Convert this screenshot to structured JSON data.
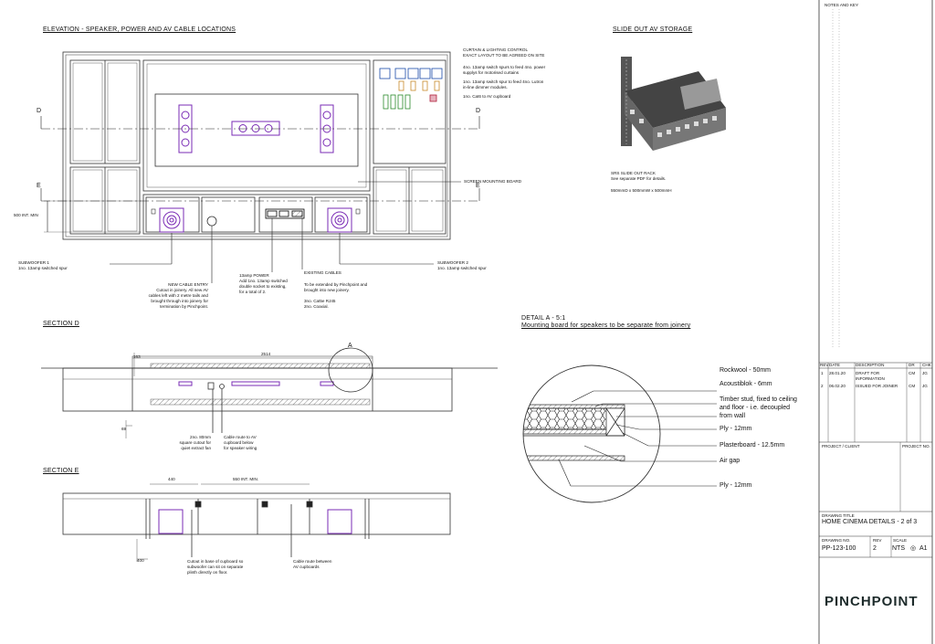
{
  "headings": {
    "elevation": "ELEVATION - SPEAKER, POWER AND AV CABLE  LOCATIONS",
    "slide_out": "SLIDE OUT AV STORAGE",
    "section_d": "SECTION D",
    "section_e": "SECTION E",
    "detail_a": "DETAIL A - 5:1",
    "detail_a_sub": "Mounting board for speakers to be separate from joinery"
  },
  "elevation_notes": {
    "curtain_title": "CURTAIN & LIGHTING CONTROL",
    "curtain_sub": "EXACT LAYOUT TO BE AGREED ON SITE",
    "curtain_1": "4no. 13amp switch spurs to feed 4no. power\nsupplys for motorised curtains",
    "curtain_2": "1no. 13amp switch spur to feed 4no. Lutron\nin-line dimmer modules.",
    "curtain_3": "1no. Cat6 to AV cupboard",
    "screen_board": "SCREEN MOUNTING BOARD",
    "sub1": "SUBWOOFER 1\n1no. 13amp switched spur",
    "sub2": "SUBWOOFER 2\n1no. 13amp switched spur",
    "cable_entry": "NEW CABLE ENTRY\nCutout in joinery. All new AV\ncables left with 2 metre tails and\nbrought through into joinery for\ntermination by Pinchpoint.",
    "power": "13amp POWER\nAdd 1no. 13amp switched\ndouble socket to existing,\nfor a total of 2.",
    "existing": "EXISTING CABLES",
    "existing_body": "To be extended by Pinchpoint and\nbrought into new joinery.\n\n3no. Cat5e RJ45\n2no. Coaxial.",
    "min_500": "500 INT. MIN",
    "marker_d": "D",
    "marker_e": "E"
  },
  "rack": {
    "title": "SRS SLIDE OUT RACK",
    "note": "See separate PDF for details.",
    "dims": "550mmD x 500mmW x 500mmH"
  },
  "section_d": {
    "dim_163": "163",
    "dim_2514": "2514",
    "dim_69": "69",
    "detail_marker": "A",
    "fan_note": "2no. 80mm\nsquare cutout for\nquiet extract fan",
    "route_note": "Cable route to AV\ncupboard below\nfor speaker wiring"
  },
  "section_e": {
    "dim_440": "440",
    "dim_550": "550 INT. MIN.",
    "dim_400": "400",
    "cutout_note": "Cutout in base of cupboard so\nsubwoofer can sit on separate\nplinth directly on floor.",
    "route_note": "Cable route between\nAV cupboards"
  },
  "detail_labels": {
    "rockwool": "Rockwool - 50mm",
    "acoustiblok": "Acoustiblok - 6mm",
    "timber": "Timber stud, fixed to ceiling\nand floor - i.e. decoupled\nfrom wall",
    "ply1": "Ply - 12mm",
    "plasterboard": "Plasterboard - 12.5mm",
    "air_gap": "Air gap",
    "ply2": "Ply - 12mm"
  },
  "title_block": {
    "notes_key": "NOTES AND KEY",
    "rev_headers": [
      "REV",
      "DATE",
      "DESCRIPTION",
      "DR",
      "CHK"
    ],
    "rev_rows": [
      [
        "1",
        "28.01.20",
        "DRAFT FOR\nINFORMATION",
        "CM",
        "JG"
      ],
      [
        "2",
        "06.02.20",
        "ISSUED FOR JOINER",
        "CM",
        "JG"
      ]
    ],
    "project_client": "PROJECT / CLIENT",
    "project_no": "PROJECT NO.",
    "drawing_title_label": "DRAWING TITLE",
    "drawing_title": "HOME CINEMA DETAILS - 2 of 3",
    "drawing_no_label": "DRAWING NO.",
    "rev_label": "REV",
    "scale_label": "SCALE",
    "drawing_no": "PP-123-100",
    "rev": "2",
    "scale": "NTS",
    "size": "A1",
    "logo": "PINCHPOINT"
  },
  "colors": {
    "ink": "#111111",
    "speaker": "#7a2bb5",
    "grey": "#9a9a9a",
    "logo": "#1d2b2b"
  }
}
